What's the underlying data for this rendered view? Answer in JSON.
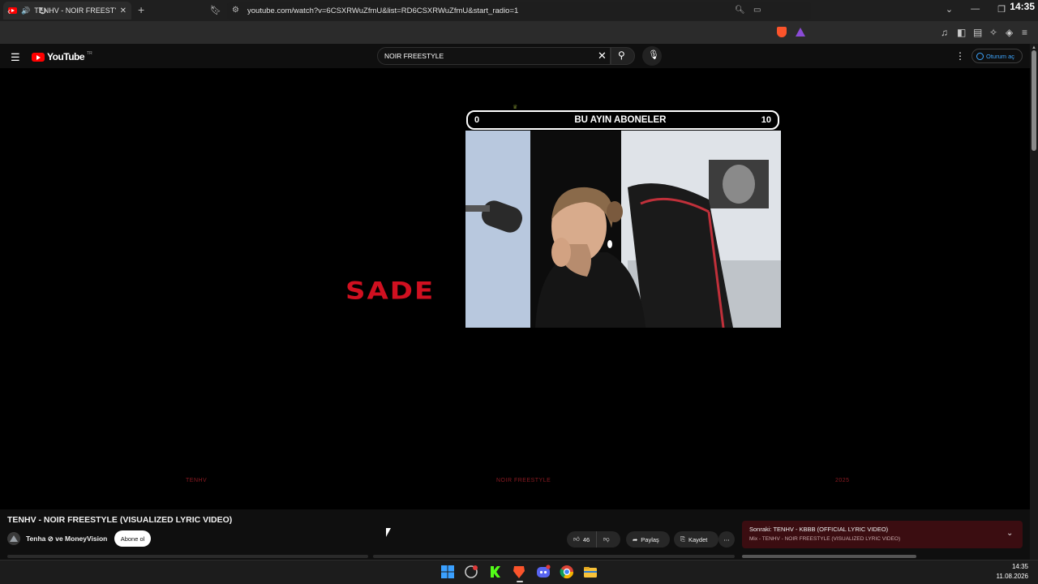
{
  "browser": {
    "tab_title": "TENHV - NOIR FREESTYLE (VI",
    "new_tab": "+",
    "url": "youtube.com/watch?v=6CSXRWuZfmU&list=RD6CSXRWuZfmU&start_radio=1",
    "clock": "14:35"
  },
  "youtube": {
    "logo_text": "YouTube",
    "country_code": "TR",
    "search_value": "NOIR FREESTYLE",
    "signin_label": "Oturum aç"
  },
  "video": {
    "overlay_left": "0",
    "overlay_title": "BU AYIN ABONELER",
    "overlay_right": "10",
    "lyric_big": "SADE",
    "lyric_left": "TENHV",
    "lyric_center": "NOIR FREESTYLE",
    "lyric_right": "2025"
  },
  "meta": {
    "title": "TENHV - NOIR FREESTYLE (VISUALIZED LYRIC VIDEO)",
    "channel": "Tenha ⊘ ve MoneyVision",
    "subscribe_label": "Abone ol",
    "likes": "46",
    "share_label": "Paylaş",
    "save_label": "Kaydet",
    "next_main": "Sonraki: TENHV - KBBB (OFFICIAL LYRIC VIDEO)",
    "next_sub": "Mix - TENHV - NOIR FREESTYLE (VISUALIZED LYRIC VIDEO)"
  },
  "taskbar": {
    "time": "14:35",
    "date": "11.08.2026"
  },
  "colors": {
    "yt_red": "#ff0000",
    "lyric_red": "#d01020",
    "next_card": "#3b0d11",
    "link_blue": "#3ea6ff"
  }
}
